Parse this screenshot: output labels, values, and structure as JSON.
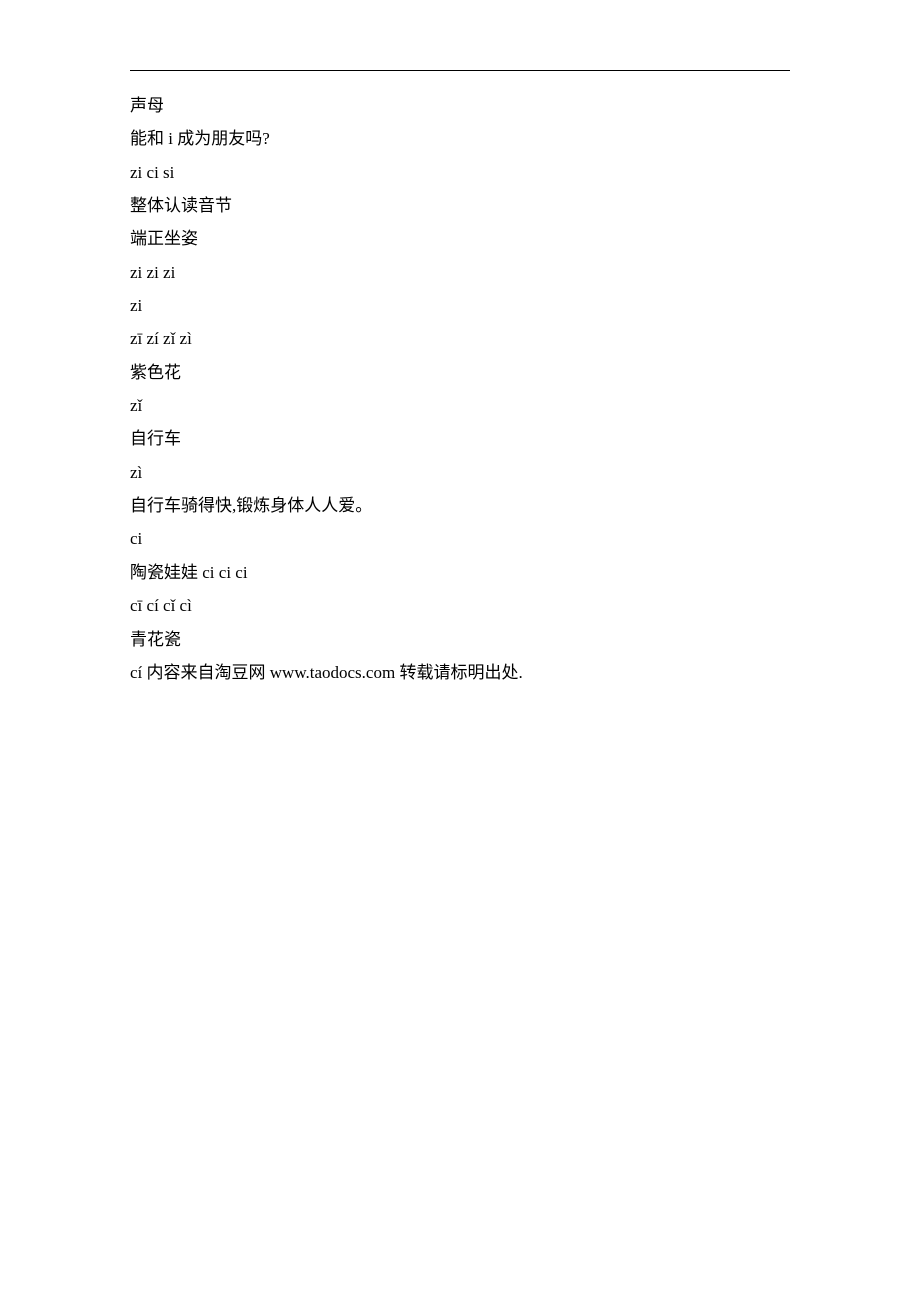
{
  "lines": [
    "声母",
    "能和 i 成为朋友吗?",
    "zi ci si",
    "整体认读音节",
    "端正坐姿",
    "zi zi zi",
    "zi",
    "zī  zí  zǐ  zì",
    "紫色花",
    "zǐ",
    "自行车",
    "zì",
    "自行车骑得快,锻炼身体人人爱。",
    "ci",
    "陶瓷娃娃 ci ci ci",
    "cī  cí  cǐ  cì",
    "青花瓷",
    "cí  内容来自淘豆网 www.taodocs.com 转载请标明出处."
  ]
}
